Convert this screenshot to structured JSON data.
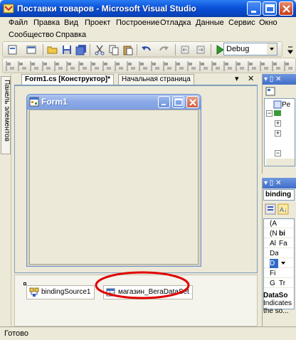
{
  "window": {
    "title": "Поставки товаров - Microsoft Visual Studio"
  },
  "menu": {
    "row1": [
      "Файл",
      "Правка",
      "Вид",
      "Проект",
      "Построение",
      "Отладка",
      "Данные",
      "Сервис",
      "Окно"
    ],
    "row2": [
      "Сообщество",
      "Справка"
    ]
  },
  "toolbar": {
    "configuration": "Debug"
  },
  "toolbox": {
    "label": "Панель элементов"
  },
  "document": {
    "tabs": [
      {
        "label": "Form1.cs [Конструктор]*",
        "active": true
      },
      {
        "label": "Начальная страница",
        "active": false
      }
    ],
    "form": {
      "title": "Form1"
    },
    "tray": {
      "items": [
        "bindingSource1",
        "магазин_BeraDataSet"
      ]
    }
  },
  "solution_explorer": {
    "head_icons": "▾ ▯ ✕",
    "node1": "Pe"
  },
  "properties": {
    "head_icons": "▾ ▯ ✕",
    "object": "binding",
    "rows": [
      {
        "name": "(A",
        "value": ""
      },
      {
        "name": "(N",
        "value": "bi"
      },
      {
        "name": "Al",
        "value": "Fa"
      },
      {
        "name": "Da",
        "value": ""
      },
      {
        "name": "D",
        "value": ""
      },
      {
        "name": "Fi",
        "value": ""
      },
      {
        "name": "G",
        "value": "Tr"
      }
    ],
    "desc_title": "DataSo",
    "desc_text": "Indicates the so..."
  },
  "status": {
    "text": "Готово"
  },
  "colors": {
    "xp_blue": "#0a52d8",
    "annotation_red": "#e00000",
    "selection": "#316ac5"
  }
}
